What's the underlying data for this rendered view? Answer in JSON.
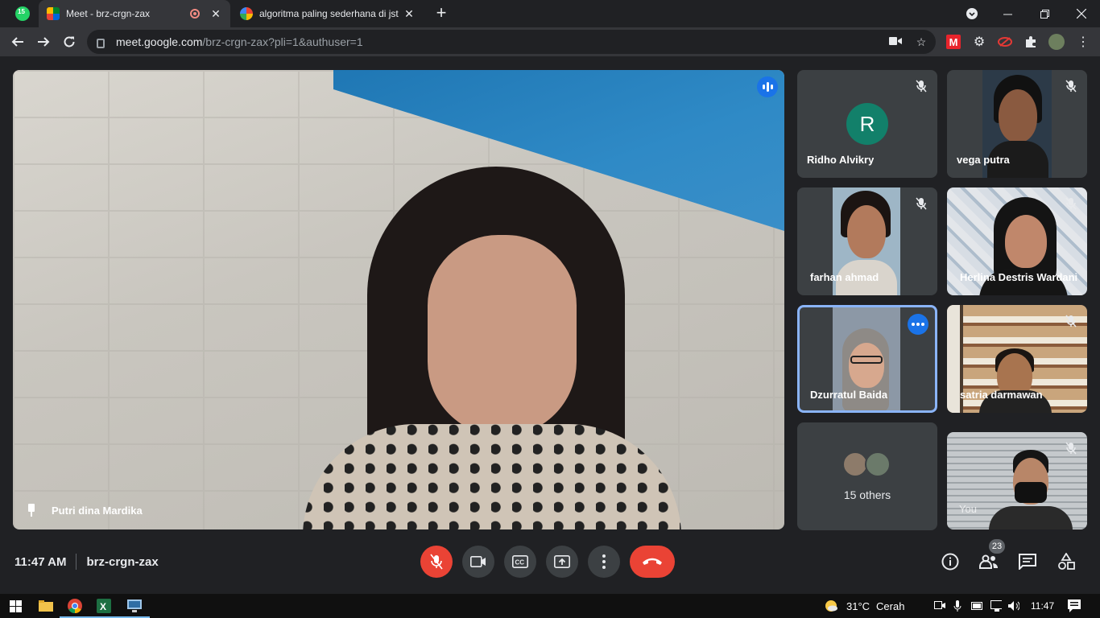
{
  "browser": {
    "pinned_tab": {
      "badge": "15",
      "icon": "whatsapp-icon"
    },
    "tabs": [
      {
        "title": "Meet - brz-crgn-zax",
        "icon": "google-meet-icon",
        "recording": true
      },
      {
        "title": "algoritma paling sederhana di jst",
        "icon": "google-icon"
      }
    ],
    "url_host": "meet.google.com",
    "url_path": "/brz-crgn-zax?pli=1&authuser=1"
  },
  "meet": {
    "main_speaker": {
      "name": "Putri dina Mardika"
    },
    "participants": [
      {
        "name": "Ridho Alvikry",
        "initial": "R",
        "muted": true
      },
      {
        "name": "vega putra",
        "muted": true
      },
      {
        "name": "farhan ahmad",
        "muted": true
      },
      {
        "name": "Herlina Destris Wardani",
        "muted": true
      },
      {
        "name": "Dzurratul Baida",
        "muted": false
      },
      {
        "name": "satria darmawan",
        "muted": true
      },
      {
        "name": "15 others"
      },
      {
        "name": "You",
        "muted": true
      }
    ],
    "time": "11:47 AM",
    "meeting_code": "brz-crgn-zax",
    "people_count": "23"
  },
  "taskbar": {
    "weather_temp": "31°C",
    "weather_text": "Cerah",
    "clock": "11:47"
  },
  "colors": {
    "meet_bg": "#202124",
    "tile_bg": "#3c4043",
    "accent_blue": "#1a73e8",
    "hangup_red": "#ea4335",
    "avatar_green": "#12806a"
  }
}
